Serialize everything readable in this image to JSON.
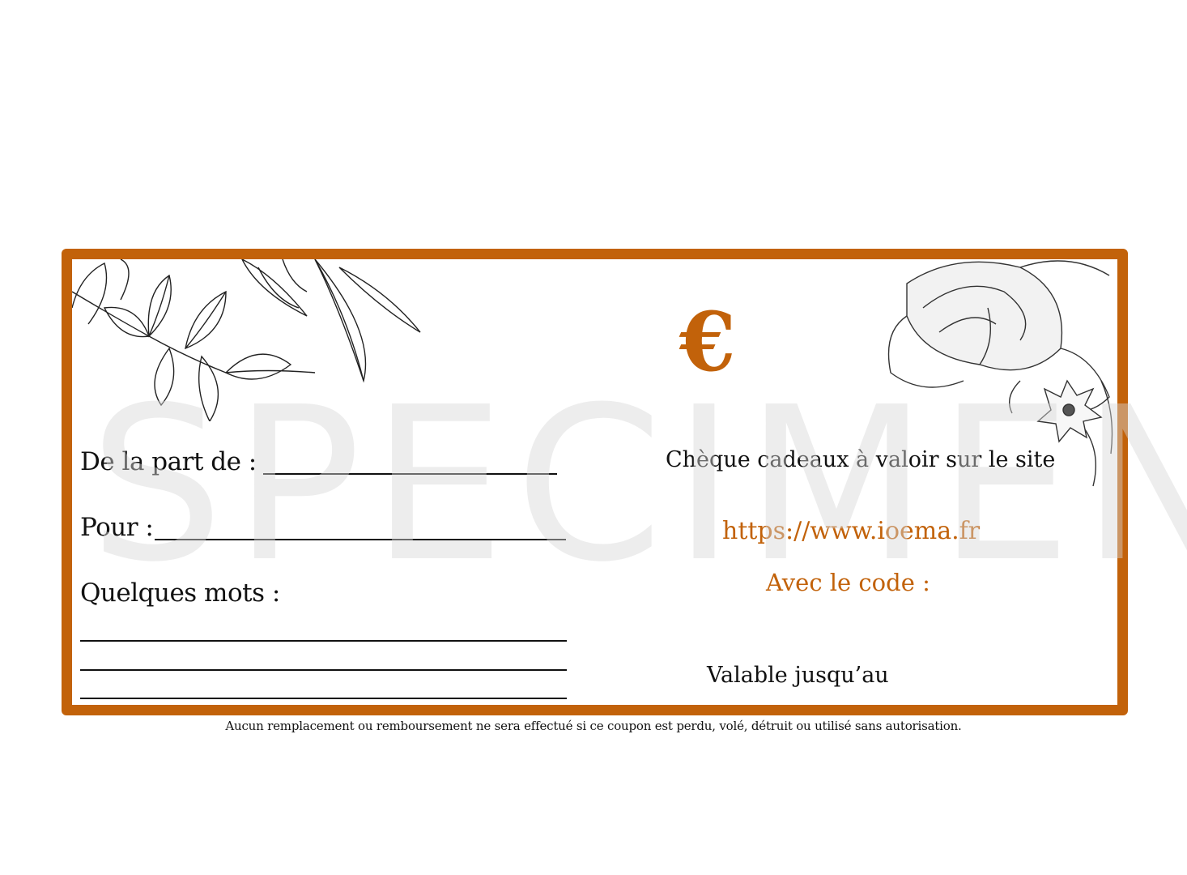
{
  "coupon": {
    "from_label": "De la part de :",
    "for_label": "Pour :",
    "message_label": "Quelques mots :",
    "currency_symbol": "€",
    "voucher_text": "Chèque cadeaux à valoir sur le site",
    "website_url": "https://www.ioema.fr",
    "code_label": "Avec le code :",
    "valid_until_label": "Valable jusqu’au",
    "disclaimer": "Aucun remplacement ou remboursement ne sera effectué si ce coupon est perdu, volé, détruit ou utilisé sans autorisation."
  },
  "watermark": "SPECIMEN",
  "colors": {
    "accent": "#c2620a",
    "text": "#111111",
    "watermark": "#d7d7d7"
  },
  "icons": [
    "leaf-branch-illustration",
    "peony-flower-illustration",
    "euro-icon"
  ]
}
